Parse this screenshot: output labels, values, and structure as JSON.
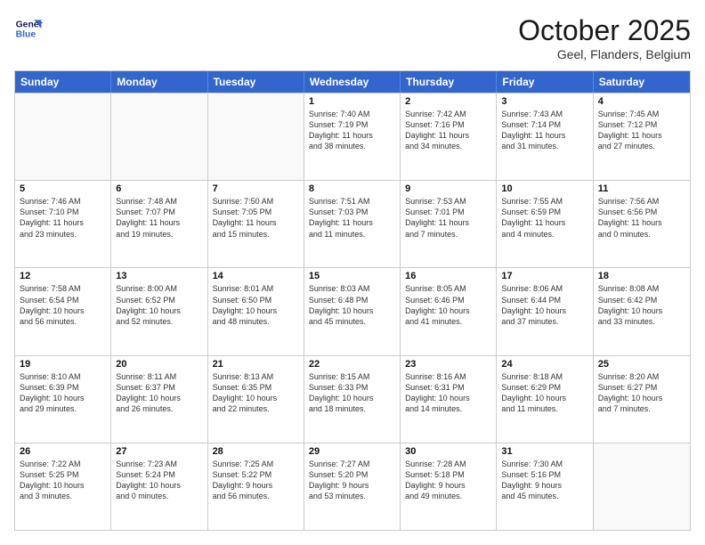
{
  "header": {
    "logo_line1": "General",
    "logo_line2": "Blue",
    "month": "October 2025",
    "location": "Geel, Flanders, Belgium"
  },
  "days_of_week": [
    "Sunday",
    "Monday",
    "Tuesday",
    "Wednesday",
    "Thursday",
    "Friday",
    "Saturday"
  ],
  "rows": [
    [
      {
        "day": "",
        "info": ""
      },
      {
        "day": "",
        "info": ""
      },
      {
        "day": "",
        "info": ""
      },
      {
        "day": "1",
        "info": "Sunrise: 7:40 AM\nSunset: 7:19 PM\nDaylight: 11 hours\nand 38 minutes."
      },
      {
        "day": "2",
        "info": "Sunrise: 7:42 AM\nSunset: 7:16 PM\nDaylight: 11 hours\nand 34 minutes."
      },
      {
        "day": "3",
        "info": "Sunrise: 7:43 AM\nSunset: 7:14 PM\nDaylight: 11 hours\nand 31 minutes."
      },
      {
        "day": "4",
        "info": "Sunrise: 7:45 AM\nSunset: 7:12 PM\nDaylight: 11 hours\nand 27 minutes."
      }
    ],
    [
      {
        "day": "5",
        "info": "Sunrise: 7:46 AM\nSunset: 7:10 PM\nDaylight: 11 hours\nand 23 minutes."
      },
      {
        "day": "6",
        "info": "Sunrise: 7:48 AM\nSunset: 7:07 PM\nDaylight: 11 hours\nand 19 minutes."
      },
      {
        "day": "7",
        "info": "Sunrise: 7:50 AM\nSunset: 7:05 PM\nDaylight: 11 hours\nand 15 minutes."
      },
      {
        "day": "8",
        "info": "Sunrise: 7:51 AM\nSunset: 7:03 PM\nDaylight: 11 hours\nand 11 minutes."
      },
      {
        "day": "9",
        "info": "Sunrise: 7:53 AM\nSunset: 7:01 PM\nDaylight: 11 hours\nand 7 minutes."
      },
      {
        "day": "10",
        "info": "Sunrise: 7:55 AM\nSunset: 6:59 PM\nDaylight: 11 hours\nand 4 minutes."
      },
      {
        "day": "11",
        "info": "Sunrise: 7:56 AM\nSunset: 6:56 PM\nDaylight: 11 hours\nand 0 minutes."
      }
    ],
    [
      {
        "day": "12",
        "info": "Sunrise: 7:58 AM\nSunset: 6:54 PM\nDaylight: 10 hours\nand 56 minutes."
      },
      {
        "day": "13",
        "info": "Sunrise: 8:00 AM\nSunset: 6:52 PM\nDaylight: 10 hours\nand 52 minutes."
      },
      {
        "day": "14",
        "info": "Sunrise: 8:01 AM\nSunset: 6:50 PM\nDaylight: 10 hours\nand 48 minutes."
      },
      {
        "day": "15",
        "info": "Sunrise: 8:03 AM\nSunset: 6:48 PM\nDaylight: 10 hours\nand 45 minutes."
      },
      {
        "day": "16",
        "info": "Sunrise: 8:05 AM\nSunset: 6:46 PM\nDaylight: 10 hours\nand 41 minutes."
      },
      {
        "day": "17",
        "info": "Sunrise: 8:06 AM\nSunset: 6:44 PM\nDaylight: 10 hours\nand 37 minutes."
      },
      {
        "day": "18",
        "info": "Sunrise: 8:08 AM\nSunset: 6:42 PM\nDaylight: 10 hours\nand 33 minutes."
      }
    ],
    [
      {
        "day": "19",
        "info": "Sunrise: 8:10 AM\nSunset: 6:39 PM\nDaylight: 10 hours\nand 29 minutes."
      },
      {
        "day": "20",
        "info": "Sunrise: 8:11 AM\nSunset: 6:37 PM\nDaylight: 10 hours\nand 26 minutes."
      },
      {
        "day": "21",
        "info": "Sunrise: 8:13 AM\nSunset: 6:35 PM\nDaylight: 10 hours\nand 22 minutes."
      },
      {
        "day": "22",
        "info": "Sunrise: 8:15 AM\nSunset: 6:33 PM\nDaylight: 10 hours\nand 18 minutes."
      },
      {
        "day": "23",
        "info": "Sunrise: 8:16 AM\nSunset: 6:31 PM\nDaylight: 10 hours\nand 14 minutes."
      },
      {
        "day": "24",
        "info": "Sunrise: 8:18 AM\nSunset: 6:29 PM\nDaylight: 10 hours\nand 11 minutes."
      },
      {
        "day": "25",
        "info": "Sunrise: 8:20 AM\nSunset: 6:27 PM\nDaylight: 10 hours\nand 7 minutes."
      }
    ],
    [
      {
        "day": "26",
        "info": "Sunrise: 7:22 AM\nSunset: 5:25 PM\nDaylight: 10 hours\nand 3 minutes."
      },
      {
        "day": "27",
        "info": "Sunrise: 7:23 AM\nSunset: 5:24 PM\nDaylight: 10 hours\nand 0 minutes."
      },
      {
        "day": "28",
        "info": "Sunrise: 7:25 AM\nSunset: 5:22 PM\nDaylight: 9 hours\nand 56 minutes."
      },
      {
        "day": "29",
        "info": "Sunrise: 7:27 AM\nSunset: 5:20 PM\nDaylight: 9 hours\nand 53 minutes."
      },
      {
        "day": "30",
        "info": "Sunrise: 7:28 AM\nSunset: 5:18 PM\nDaylight: 9 hours\nand 49 minutes."
      },
      {
        "day": "31",
        "info": "Sunrise: 7:30 AM\nSunset: 5:16 PM\nDaylight: 9 hours\nand 45 minutes."
      },
      {
        "day": "",
        "info": ""
      }
    ]
  ]
}
